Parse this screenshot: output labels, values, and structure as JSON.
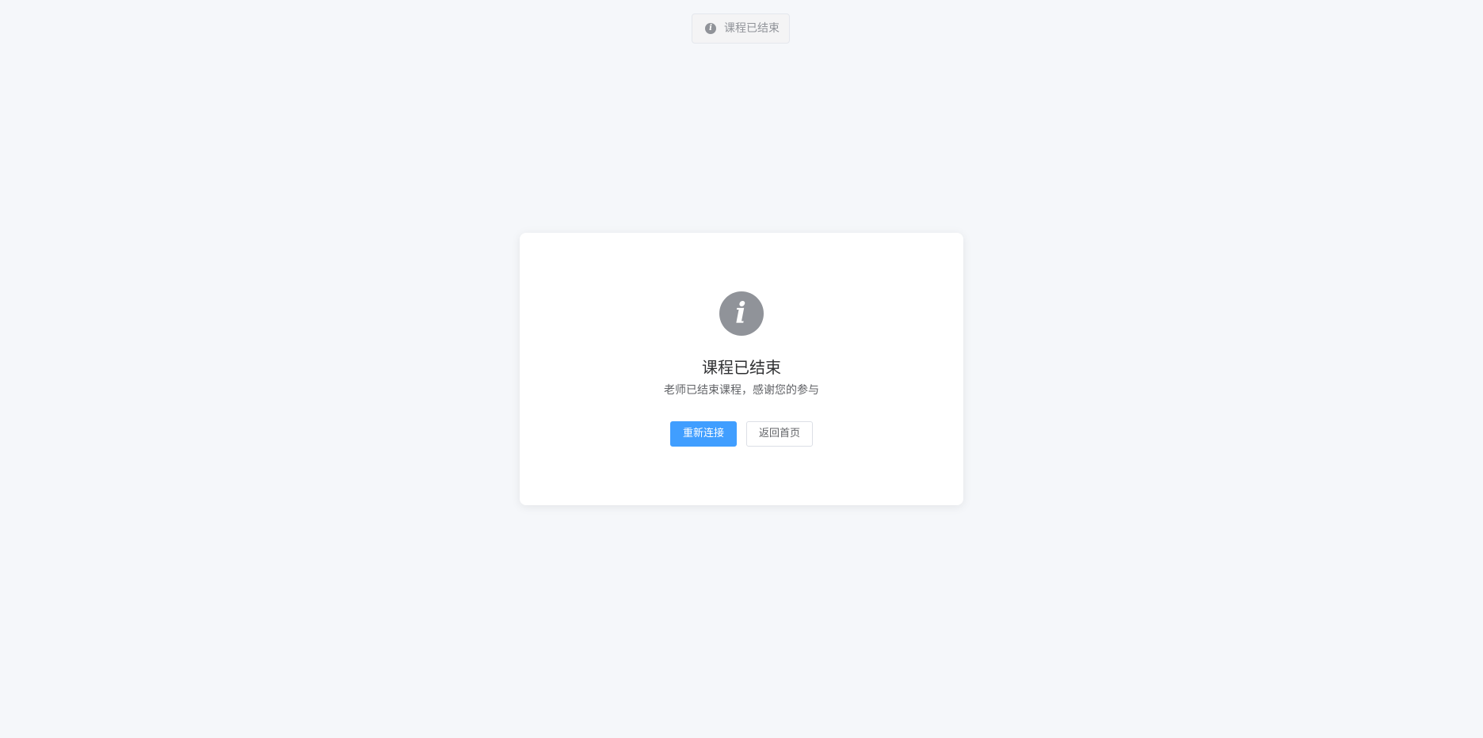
{
  "toast": {
    "icon": "info-icon",
    "message": "课程已结束"
  },
  "card": {
    "icon": "info-circle-icon",
    "title": "课程已结束",
    "subtitle": "老师已结束课程，感谢您的参与",
    "buttons": {
      "reconnect_label": "重新连接",
      "home_label": "返回首页"
    }
  },
  "colors": {
    "background": "#f5f7fa",
    "primary": "#409eff",
    "info": "#909399",
    "title_text": "#303133",
    "body_text": "#606266"
  }
}
